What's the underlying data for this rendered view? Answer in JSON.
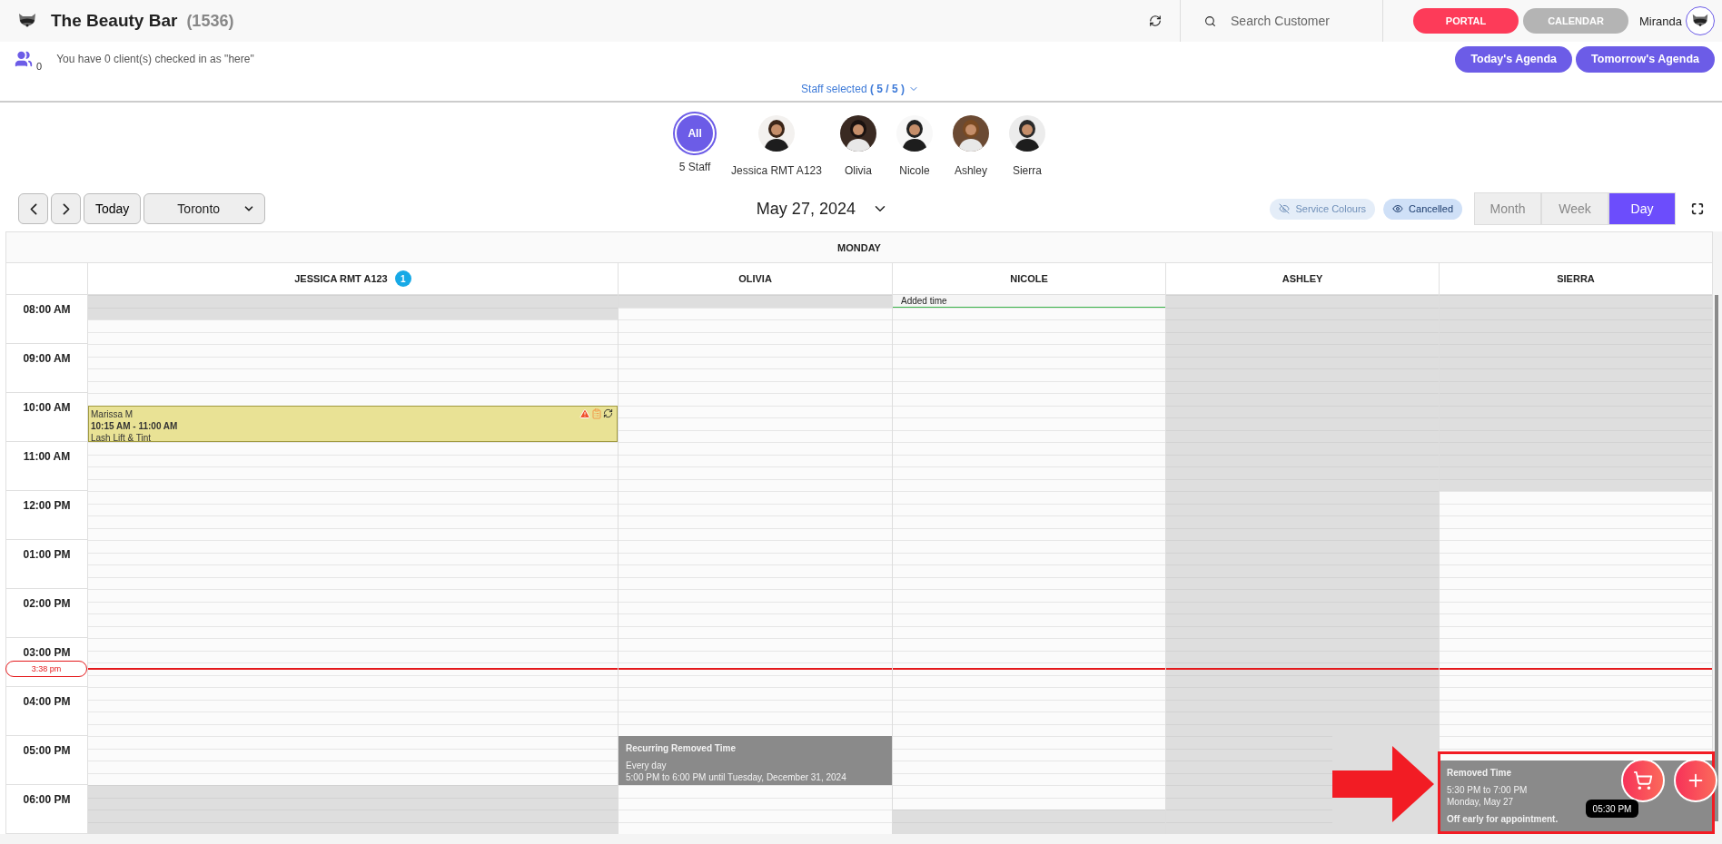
{
  "header": {
    "brand": "The Beauty Bar",
    "count": "(1536)",
    "search": {
      "placeholder": "Search Customer"
    },
    "nav": [
      {
        "label": "PORTAL",
        "selected": true
      },
      {
        "label": "CALENDAR",
        "selected": false
      }
    ],
    "user": "Miranda"
  },
  "checkin": {
    "count": "0",
    "message": "You have 0 client(s) checked in as \"here\""
  },
  "agenda_buttons": [
    "Today's Agenda",
    "Tomorrow's Agenda"
  ],
  "staff_selected": {
    "label": "Staff selected",
    "count": "( 5 / 5 )"
  },
  "staff": [
    {
      "kind": "all",
      "label": "All",
      "name": "5 Staff",
      "selected": true
    },
    {
      "kind": "person",
      "name": "Jessica RMT A123",
      "selected": false
    },
    {
      "kind": "person",
      "name": "Olivia",
      "selected": false
    },
    {
      "kind": "person",
      "name": "Nicole",
      "selected": false
    },
    {
      "kind": "person",
      "name": "Ashley",
      "selected": false
    },
    {
      "kind": "person",
      "name": "Sierra",
      "selected": false
    }
  ],
  "toolbar": {
    "today": "Today",
    "location": "Toronto",
    "date": "May 27, 2024",
    "toggles": [
      {
        "label": "Service Colours",
        "on": false
      },
      {
        "label": "Cancelled",
        "on": true
      }
    ],
    "views": [
      {
        "label": "Month",
        "selected": false
      },
      {
        "label": "Week",
        "selected": false
      },
      {
        "label": "Day",
        "selected": true
      }
    ]
  },
  "calendar": {
    "day": "MONDAY",
    "hours": [
      "08:00 AM",
      "09:00 AM",
      "10:00 AM",
      "11:00 AM",
      "12:00 PM",
      "01:00 PM",
      "02:00 PM",
      "03:00 PM",
      "04:00 PM",
      "05:00 PM",
      "06:00 PM"
    ],
    "now": {
      "label": "3:38 pm"
    },
    "columns": [
      {
        "name": "JESSICA RMT A123",
        "badge": "1",
        "slots": [
          {
            "kind": "slot",
            "off": true
          },
          {
            "kind": "slot",
            "off": true
          },
          {
            "kind": "slot",
            "off": false
          },
          {
            "kind": "slot",
            "off": false
          },
          {
            "kind": "slot",
            "off": false
          },
          {
            "kind": "slot",
            "off": false
          },
          {
            "kind": "slot",
            "off": false
          },
          {
            "kind": "slot",
            "off": false
          },
          {
            "kind": "slot",
            "off": false
          },
          {
            "kind": "appointment",
            "client": "Marissa M",
            "time": "10:15 AM - 11:00 AM",
            "service": "Lash Lift & Tint"
          },
          {
            "kind": "slot",
            "off": false
          },
          {
            "kind": "slot",
            "off": false
          },
          {
            "kind": "slot",
            "off": false
          },
          {
            "kind": "slot",
            "off": false
          },
          {
            "kind": "slot",
            "off": false
          },
          {
            "kind": "slot",
            "off": false
          },
          {
            "kind": "slot",
            "off": false
          },
          {
            "kind": "slot",
            "off": false
          },
          {
            "kind": "slot",
            "off": false
          },
          {
            "kind": "slot",
            "off": false
          },
          {
            "kind": "slot",
            "off": false
          },
          {
            "kind": "slot",
            "off": false
          },
          {
            "kind": "slot",
            "off": false
          },
          {
            "kind": "slot",
            "off": false
          },
          {
            "kind": "slot",
            "off": false
          },
          {
            "kind": "slot",
            "off": false
          },
          {
            "kind": "slot",
            "off": false
          },
          {
            "kind": "slot",
            "off": false
          },
          {
            "kind": "slot",
            "off": false
          },
          {
            "kind": "slot",
            "off": false
          },
          {
            "kind": "slot",
            "off": false
          },
          {
            "kind": "slot",
            "off": false
          },
          {
            "kind": "slot",
            "off": false
          },
          {
            "kind": "slot",
            "off": false
          },
          {
            "kind": "slot",
            "off": false
          },
          {
            "kind": "slot",
            "off": false
          },
          {
            "kind": "slot",
            "off": false
          },
          {
            "kind": "slot",
            "off": false
          },
          {
            "kind": "slot",
            "off": true
          },
          {
            "kind": "slot",
            "off": true
          },
          {
            "kind": "slot",
            "off": true
          },
          {
            "kind": "slot",
            "off": true
          }
        ]
      },
      {
        "name": "OLIVIA",
        "slots": [
          {
            "kind": "slot",
            "off": true
          },
          {
            "kind": "slot",
            "off": false
          },
          {
            "kind": "slot",
            "off": false
          },
          {
            "kind": "slot",
            "off": false
          },
          {
            "kind": "slot",
            "off": false
          },
          {
            "kind": "slot",
            "off": false
          },
          {
            "kind": "slot",
            "off": false
          },
          {
            "kind": "slot",
            "off": false
          },
          {
            "kind": "slot",
            "off": false
          },
          {
            "kind": "slot",
            "off": false
          },
          {
            "kind": "slot",
            "off": false
          },
          {
            "kind": "slot",
            "off": false
          },
          {
            "kind": "slot",
            "off": false
          },
          {
            "kind": "slot",
            "off": false
          },
          {
            "kind": "slot",
            "off": false
          },
          {
            "kind": "slot",
            "off": false
          },
          {
            "kind": "slot",
            "off": false
          },
          {
            "kind": "slot",
            "off": false
          },
          {
            "kind": "slot",
            "off": false
          },
          {
            "kind": "slot",
            "off": false
          },
          {
            "kind": "slot",
            "off": false
          },
          {
            "kind": "slot",
            "off": false
          },
          {
            "kind": "slot",
            "off": false
          },
          {
            "kind": "slot",
            "off": false
          },
          {
            "kind": "slot",
            "off": false
          },
          {
            "kind": "slot",
            "off": false
          },
          {
            "kind": "slot",
            "off": false
          },
          {
            "kind": "slot",
            "off": false
          },
          {
            "kind": "slot",
            "off": false
          },
          {
            "kind": "slot",
            "off": false
          },
          {
            "kind": "slot",
            "off": false
          },
          {
            "kind": "slot",
            "off": false
          },
          {
            "kind": "slot",
            "off": false
          },
          {
            "kind": "slot",
            "off": false
          },
          {
            "kind": "slot",
            "off": false
          },
          {
            "kind": "slot",
            "off": false
          },
          {
            "kind": "removed",
            "title": "Recurring Removed Time",
            "lines": [
              "Every day",
              "5:00 PM to 6:00 PM until Tuesday, December 31, 2024"
            ]
          },
          {
            "kind": "slot",
            "off": false
          },
          {
            "kind": "slot",
            "off": false
          },
          {
            "kind": "slot",
            "off": false
          },
          {
            "kind": "slot",
            "off": false
          }
        ]
      },
      {
        "name": "NICOLE",
        "slots": [
          {
            "kind": "added",
            "title": "Added time"
          },
          {
            "kind": "slot",
            "off": false
          },
          {
            "kind": "slot",
            "off": false
          },
          {
            "kind": "slot",
            "off": false
          },
          {
            "kind": "slot",
            "off": false
          },
          {
            "kind": "slot",
            "off": false
          },
          {
            "kind": "slot",
            "off": false
          },
          {
            "kind": "slot",
            "off": false
          },
          {
            "kind": "slot",
            "off": false
          },
          {
            "kind": "slot",
            "off": false
          },
          {
            "kind": "slot",
            "off": false
          },
          {
            "kind": "slot",
            "off": false
          },
          {
            "kind": "slot",
            "off": false
          },
          {
            "kind": "slot",
            "off": false
          },
          {
            "kind": "slot",
            "off": false
          },
          {
            "kind": "slot",
            "off": false
          },
          {
            "kind": "slot",
            "off": false
          },
          {
            "kind": "slot",
            "off": false
          },
          {
            "kind": "slot",
            "off": false
          },
          {
            "kind": "slot",
            "off": false
          },
          {
            "kind": "slot",
            "off": false
          },
          {
            "kind": "slot",
            "off": false
          },
          {
            "kind": "slot",
            "off": false
          },
          {
            "kind": "slot",
            "off": false
          },
          {
            "kind": "slot",
            "off": false
          },
          {
            "kind": "slot",
            "off": false
          },
          {
            "kind": "slot",
            "off": false
          },
          {
            "kind": "slot",
            "off": false
          },
          {
            "kind": "slot",
            "off": false
          },
          {
            "kind": "slot",
            "off": false
          },
          {
            "kind": "slot",
            "off": false
          },
          {
            "kind": "slot",
            "off": false
          },
          {
            "kind": "slot",
            "off": false
          },
          {
            "kind": "slot",
            "off": false
          },
          {
            "kind": "slot",
            "off": false
          },
          {
            "kind": "slot",
            "off": false
          },
          {
            "kind": "slot",
            "off": false
          },
          {
            "kind": "slot",
            "off": false
          },
          {
            "kind": "slot",
            "off": false
          },
          {
            "kind": "slot",
            "off": false
          },
          {
            "kind": "slot",
            "off": false
          },
          {
            "kind": "slot",
            "off": false
          },
          {
            "kind": "slot",
            "off": true
          },
          {
            "kind": "slot",
            "off": true
          }
        ]
      },
      {
        "name": "ASHLEY",
        "slots": [
          {
            "kind": "slot",
            "off": true
          },
          {
            "kind": "slot",
            "off": true
          },
          {
            "kind": "slot",
            "off": true
          },
          {
            "kind": "slot",
            "off": true
          },
          {
            "kind": "slot",
            "off": true
          },
          {
            "kind": "slot",
            "off": true
          },
          {
            "kind": "slot",
            "off": true
          },
          {
            "kind": "slot",
            "off": true
          },
          {
            "kind": "slot",
            "off": true
          },
          {
            "kind": "slot",
            "off": true
          },
          {
            "kind": "slot",
            "off": true
          },
          {
            "kind": "slot",
            "off": true
          },
          {
            "kind": "slot",
            "off": true
          },
          {
            "kind": "slot",
            "off": true
          },
          {
            "kind": "slot",
            "off": true
          },
          {
            "kind": "slot",
            "off": true
          },
          {
            "kind": "slot",
            "off": true
          },
          {
            "kind": "slot",
            "off": true
          },
          {
            "kind": "slot",
            "off": true
          },
          {
            "kind": "slot",
            "off": true
          },
          {
            "kind": "slot",
            "off": true
          },
          {
            "kind": "slot",
            "off": true
          },
          {
            "kind": "slot",
            "off": true
          },
          {
            "kind": "slot",
            "off": true
          },
          {
            "kind": "slot",
            "off": true
          },
          {
            "kind": "slot",
            "off": true
          },
          {
            "kind": "slot",
            "off": true
          },
          {
            "kind": "slot",
            "off": true
          },
          {
            "kind": "slot",
            "off": true
          },
          {
            "kind": "slot",
            "off": true
          },
          {
            "kind": "slot",
            "off": true
          },
          {
            "kind": "slot",
            "off": true
          },
          {
            "kind": "slot",
            "off": true
          },
          {
            "kind": "slot",
            "off": true
          },
          {
            "kind": "slot",
            "off": true
          },
          {
            "kind": "slot",
            "off": true
          },
          {
            "kind": "slot",
            "off": true
          },
          {
            "kind": "slot",
            "off": true
          },
          {
            "kind": "slot",
            "off": true
          },
          {
            "kind": "slot",
            "off": true
          },
          {
            "kind": "slot",
            "off": true
          },
          {
            "kind": "slot",
            "off": true
          },
          {
            "kind": "slot",
            "off": true
          },
          {
            "kind": "slot",
            "off": true
          }
        ]
      },
      {
        "name": "SIERRA",
        "slots": [
          {
            "kind": "slot",
            "off": true
          },
          {
            "kind": "slot",
            "off": true
          },
          {
            "kind": "slot",
            "off": true
          },
          {
            "kind": "slot",
            "off": true
          },
          {
            "kind": "slot",
            "off": true
          },
          {
            "kind": "slot",
            "off": true
          },
          {
            "kind": "slot",
            "off": true
          },
          {
            "kind": "slot",
            "off": true
          },
          {
            "kind": "slot",
            "off": true
          },
          {
            "kind": "slot",
            "off": true
          },
          {
            "kind": "slot",
            "off": true
          },
          {
            "kind": "slot",
            "off": true
          },
          {
            "kind": "slot",
            "off": true
          },
          {
            "kind": "slot",
            "off": true
          },
          {
            "kind": "slot",
            "off": true
          },
          {
            "kind": "slot",
            "off": true
          },
          {
            "kind": "slot",
            "off": false
          },
          {
            "kind": "slot",
            "off": false
          },
          {
            "kind": "slot",
            "off": false
          },
          {
            "kind": "slot",
            "off": false
          },
          {
            "kind": "slot",
            "off": false
          },
          {
            "kind": "slot",
            "off": false
          },
          {
            "kind": "slot",
            "off": false
          },
          {
            "kind": "slot",
            "off": false
          },
          {
            "kind": "slot",
            "off": false
          },
          {
            "kind": "slot",
            "off": false
          },
          {
            "kind": "slot",
            "off": false
          },
          {
            "kind": "slot",
            "off": false
          },
          {
            "kind": "slot",
            "off": false
          },
          {
            "kind": "slot",
            "off": false
          },
          {
            "kind": "slot",
            "off": false
          },
          {
            "kind": "slot",
            "off": false
          },
          {
            "kind": "slot",
            "off": false
          },
          {
            "kind": "slot",
            "off": false
          },
          {
            "kind": "slot",
            "off": false
          },
          {
            "kind": "slot",
            "off": false
          },
          {
            "kind": "slot",
            "off": false
          },
          {
            "kind": "slot",
            "off": false
          },
          {
            "kind": "removed",
            "title": "Removed Time",
            "lines": [
              "5:30 PM to 7:00 PM",
              "Monday, May 27"
            ],
            "note": "Off early for appointment."
          }
        ]
      }
    ],
    "tooltip": "05:30 PM"
  },
  "callout": {
    "arrow": true,
    "highlight": true
  }
}
